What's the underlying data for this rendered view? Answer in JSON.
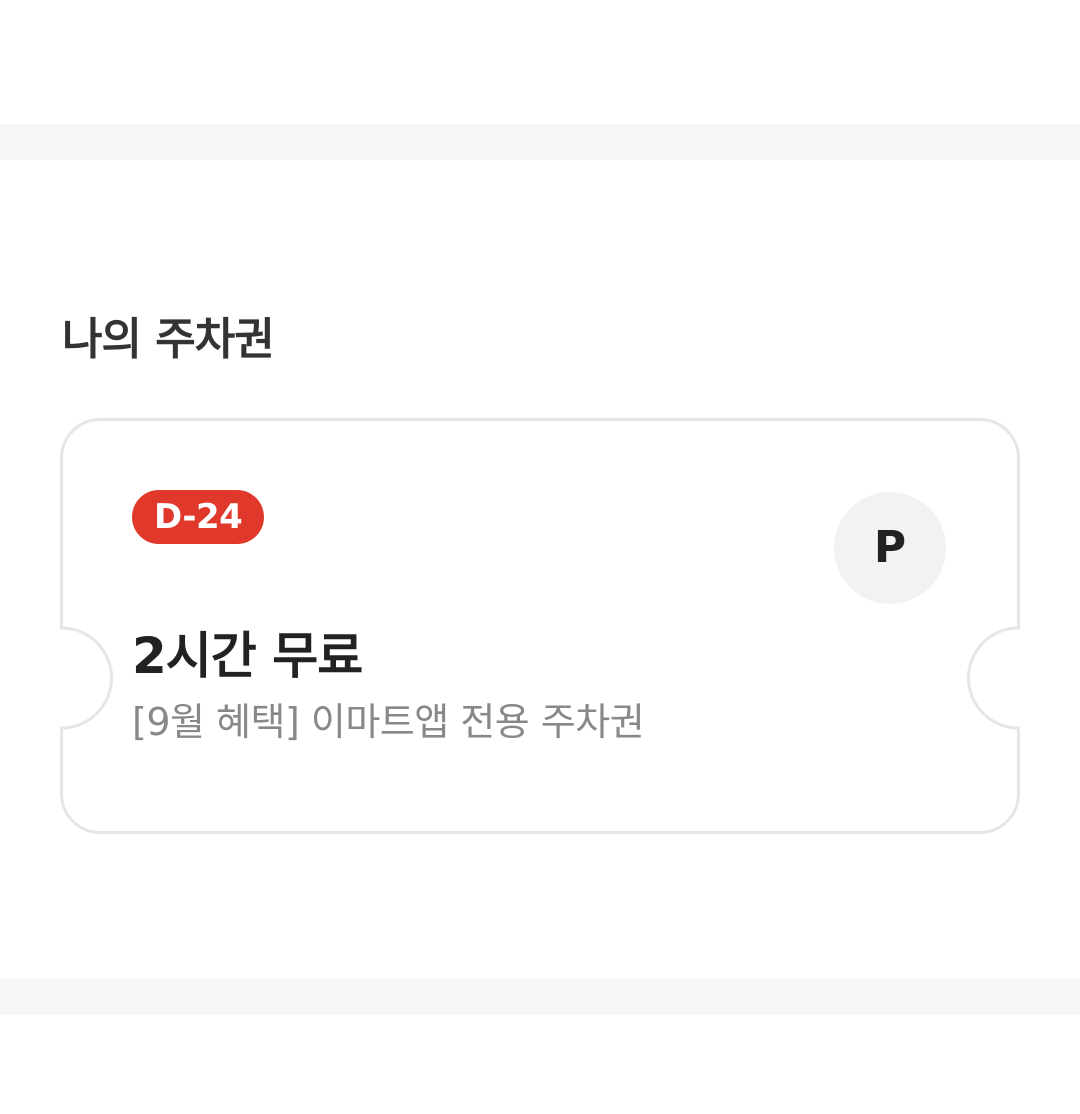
{
  "section": {
    "title": "나의 주차권"
  },
  "ticket": {
    "badge": "D-24",
    "icon_label": "P",
    "title": "2시간 무료",
    "description": "[9월 혜택] 이마트앱 전용 주차권"
  },
  "colors": {
    "badge": "#e0382b",
    "border": "#e6e6e6",
    "divider": "#f6f6f6",
    "title_text": "#222222",
    "description_text": "#888888"
  },
  "icons": {
    "parking": "parking-icon"
  }
}
